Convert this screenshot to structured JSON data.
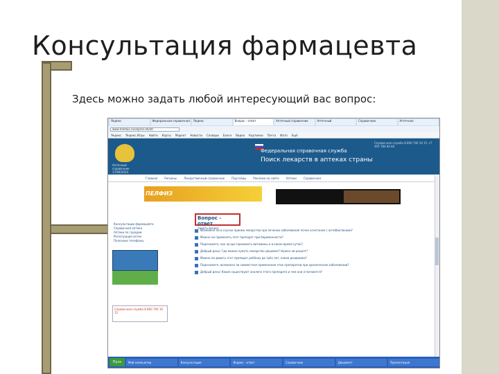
{
  "slide": {
    "title": "Консультация фармацевта",
    "subtitle": "Здесь можно задать любой интересующий вас вопрос:"
  },
  "browser": {
    "tabs": [
      "Яндекс",
      "Федеральная справочная...",
      "Яндекс",
      "Вопрос - ответ",
      "Аптечный справочник",
      "Аптечный",
      "Справочник",
      "Аптечная"
    ],
    "address": "www.medlux.ru/vopros-otvet/",
    "bookmarks": [
      "Яндекс",
      "Яндекс.Игры",
      "Найти",
      "Карты",
      "Маркет",
      "Новости",
      "Словари",
      "Блоги",
      "Видео",
      "Картинки",
      "Почта",
      "Фото",
      "Ещё"
    ]
  },
  "site": {
    "header_title": "Федеральная справочная служба",
    "header_subtitle": "Поиск лекарств в аптеках страны",
    "emblem_caption": "Аптечный справочник 17/04/2024",
    "contact": "Справочная служба 8 800 700 10 15 +7 495 784 84 84",
    "menu": [
      "Главная",
      "Регионы",
      "Лекарственный справочник",
      "Партнёры",
      "Реклама на сайте",
      "Аптеки",
      "Справочная"
    ],
    "banner_text": "ПЕЛФИЗ",
    "sidebar_links": [
      "Консультации фармацевта",
      "Справочная аптека",
      "Аптеки по городам",
      "Регистрация аптек",
      "Полезные телефоны"
    ],
    "sidebar_note": "Справочная служба 8 800 700 10 15"
  },
  "qa": {
    "title": "Вопрос - ответ",
    "ask_link": "Задать вопрос",
    "items": [
      "Возможно ли в случае приема лекарства при лечении заболевания почек сочетание с антибиотиками?",
      "Можно ли применять этот препарат при беременности?",
      "Подскажите, как лучше принимать витамины и в какое время суток?",
      "Добрый день! Где можно купить лекарство дешевле? Нужен ли рецепт?",
      "Можно ли давать этот препарат ребёнку до трёх лет, какая дозировка?",
      "Подскажите, возможно ли совместное применение этих препаратов при хроническом заболевании?",
      "Добрый день! Какие существуют аналоги этого препарата и чем они отличаются?"
    ]
  },
  "taskbar": {
    "start": "Пуск",
    "items": [
      "Мой компьютер",
      "Консультация",
      "Яндекс - ответ",
      "Справочник",
      "Документ",
      "Презентация"
    ]
  }
}
